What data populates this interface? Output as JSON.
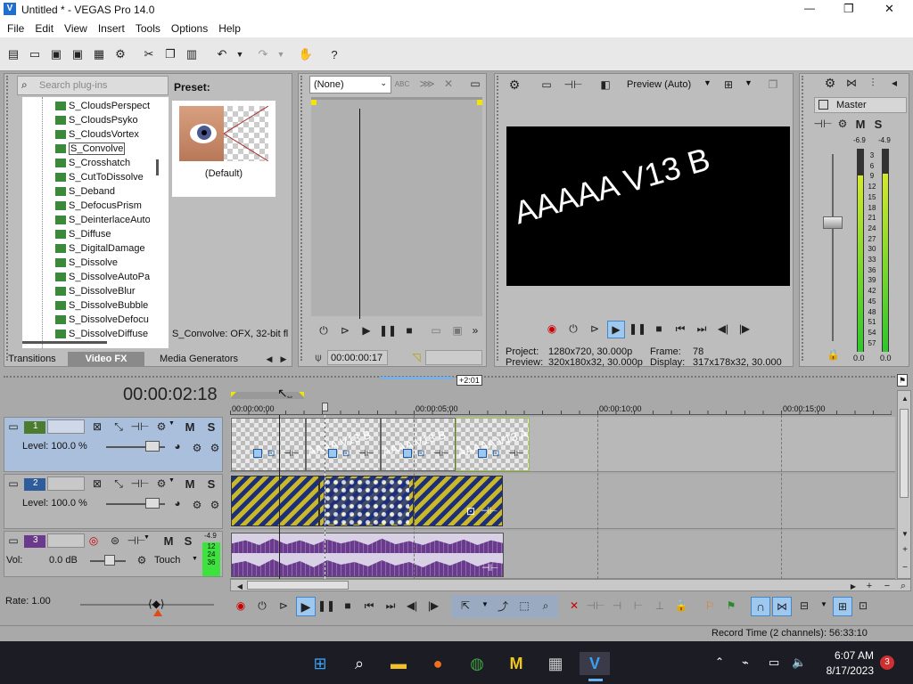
{
  "window": {
    "title": "Untitled * - VEGAS Pro 14.0",
    "minimize": "—",
    "maximize": "❐",
    "close": "✕"
  },
  "menu": [
    "File",
    "Edit",
    "View",
    "Insert",
    "Tools",
    "Options",
    "Help"
  ],
  "plugins": {
    "search_placeholder": "Search plug-ins",
    "items": [
      "S_CloudsPerspect",
      "S_CloudsPsyko",
      "S_CloudsVortex",
      "S_Convolve",
      "S_Crosshatch",
      "S_CutToDissolve",
      "S_Deband",
      "S_DefocusPrism",
      "S_DeinterlaceAuto",
      "S_Diffuse",
      "S_DigitalDamage",
      "S_Dissolve",
      "S_DissolveAutoPa",
      "S_DissolveBlur",
      "S_DissolveBubble",
      "S_DissolveDefocu",
      "S_DissolveDiffuse"
    ],
    "selected": "S_Convolve",
    "preset_label": "Preset:",
    "preset_name": "(Default)",
    "status": "S_Convolve: OFX, 32-bit fl",
    "tabs": [
      "Transitions",
      "Video FX",
      "Media Generators"
    ],
    "active_tab": "Video FX"
  },
  "trimmer": {
    "dropdown": "(None)",
    "timecode": "00:00:00:17"
  },
  "preview": {
    "mode": "Preview (Auto)",
    "video_text": "AAAAA V13 B",
    "project_label": "Project:",
    "project_value": "1280x720, 30.000p",
    "frame_label": "Frame:",
    "frame_value": "78",
    "preview_label": "Preview:",
    "preview_value": "320x180x32, 30.000p",
    "display_label": "Display:",
    "display_value": "317x178x32, 30.000"
  },
  "master": {
    "label": "Master",
    "peak_left": "-6.9",
    "peak_right": "-4.9",
    "scale": [
      "3",
      "6",
      "9",
      "12",
      "15",
      "18",
      "21",
      "24",
      "27",
      "30",
      "33",
      "36",
      "39",
      "42",
      "45",
      "48",
      "51",
      "54",
      "57"
    ],
    "bottom_left": "0.0",
    "bottom_right": "0.0"
  },
  "timeline": {
    "timecode": "00:00:02:18",
    "loop_badge": "+2:01",
    "ruler": [
      "00:00:00;00",
      "00:00:05;00",
      "00:00:10;00",
      "00:00:15;00"
    ],
    "tracks": [
      {
        "num": "1",
        "level": "Level: 100.0 %",
        "m": "M",
        "s": "S"
      },
      {
        "num": "2",
        "level": "Level: 100.0 %",
        "m": "M",
        "s": "S"
      },
      {
        "num": "3",
        "vol_label": "Vol:",
        "vol_value": "0.0 dB",
        "touch": "Touch",
        "m": "M",
        "s": "S",
        "peak": "-4.9",
        "meter": [
          "12",
          "24",
          "36"
        ]
      }
    ],
    "clip_texts": [
      "AAAA V13 B",
      "AAAA V13 B",
      "AAAAA V13 A"
    ],
    "rate": "Rate: 1.00",
    "record_time": "Record Time (2 channels): 56:33:10"
  },
  "taskbar": {
    "time": "6:07 AM",
    "date": "8/17/2023",
    "badge": "3"
  }
}
